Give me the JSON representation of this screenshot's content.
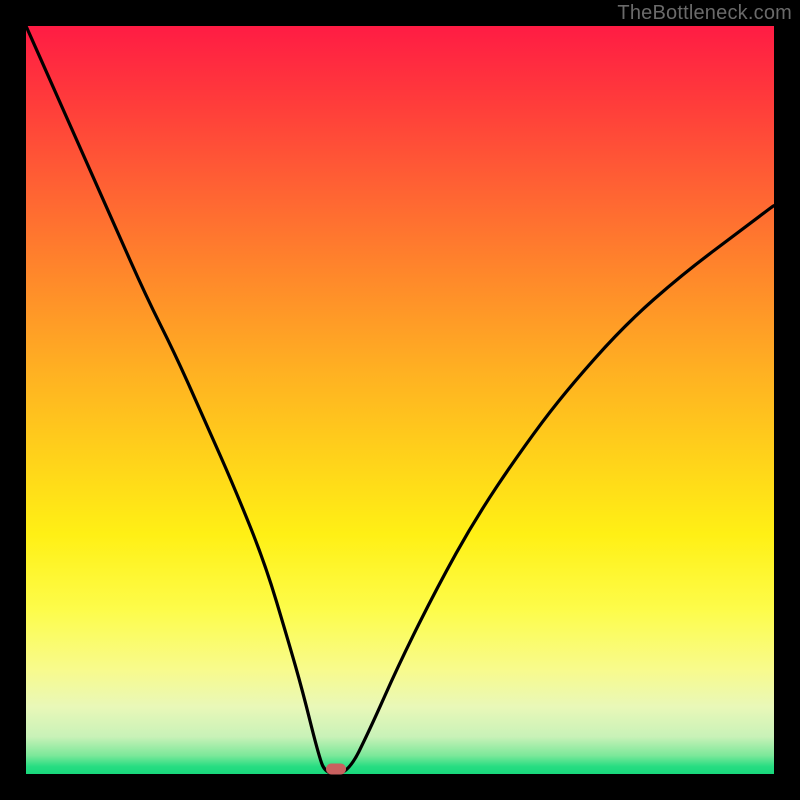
{
  "watermark": "TheBottleneck.com",
  "marker": {
    "x_pct": 41.5,
    "y_pct": 99.3,
    "color": "#c9605f"
  },
  "chart_data": {
    "type": "line",
    "title": "",
    "xlabel": "",
    "ylabel": "",
    "xlim": [
      0,
      100
    ],
    "ylim": [
      0,
      100
    ],
    "grid": false,
    "series": [
      {
        "name": "bottleneck-curve",
        "x": [
          0,
          4,
          8,
          12,
          16,
          20,
          24,
          28,
          32,
          35,
          37,
          39,
          40,
          43,
          46,
          50,
          55,
          60,
          66,
          72,
          80,
          88,
          96,
          100
        ],
        "values": [
          100,
          91,
          82,
          73,
          64,
          56,
          47,
          38,
          28,
          18,
          11,
          3,
          0,
          0,
          6,
          15,
          25,
          34,
          43,
          51,
          60,
          67,
          73,
          76
        ]
      },
      {
        "name": "marker-point",
        "x": [
          41.5
        ],
        "values": [
          0.7
        ]
      }
    ],
    "background_gradient": {
      "direction": "vertical",
      "stops": [
        {
          "pos": 0.0,
          "color": "#ff1c44"
        },
        {
          "pos": 0.1,
          "color": "#ff3b3b"
        },
        {
          "pos": 0.22,
          "color": "#ff6333"
        },
        {
          "pos": 0.34,
          "color": "#ff8a2a"
        },
        {
          "pos": 0.46,
          "color": "#ffb022"
        },
        {
          "pos": 0.58,
          "color": "#ffd31a"
        },
        {
          "pos": 0.68,
          "color": "#fff015"
        },
        {
          "pos": 0.78,
          "color": "#fdfc4a"
        },
        {
          "pos": 0.86,
          "color": "#f8fb8c"
        },
        {
          "pos": 0.91,
          "color": "#e9f8b8"
        },
        {
          "pos": 0.95,
          "color": "#c9f2b8"
        },
        {
          "pos": 0.975,
          "color": "#7de89a"
        },
        {
          "pos": 0.99,
          "color": "#27dd82"
        },
        {
          "pos": 1.0,
          "color": "#18d87c"
        }
      ]
    }
  }
}
